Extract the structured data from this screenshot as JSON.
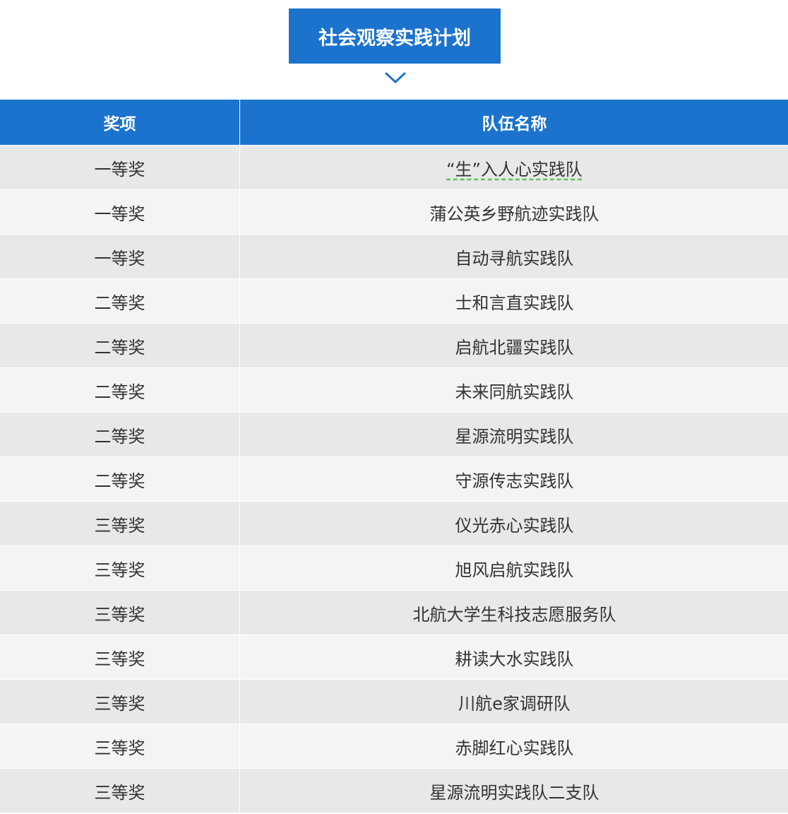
{
  "title": "社会观察实践计划",
  "colors": {
    "accent": "#1b73cd",
    "row_odd": "#e8e8e8",
    "row_even": "#f4f4f4",
    "text": "#333333"
  },
  "table": {
    "headers": [
      "奖项",
      "队伍名称"
    ],
    "rows": [
      {
        "award": "一等奖",
        "team": "“生”入人心实践队"
      },
      {
        "award": "一等奖",
        "team": "蒲公英乡野航迹实践队"
      },
      {
        "award": "一等奖",
        "team": "自动寻航实践队"
      },
      {
        "award": "二等奖",
        "team": "士和言直实践队"
      },
      {
        "award": "二等奖",
        "team": "启航北疆实践队"
      },
      {
        "award": "二等奖",
        "team": "未来同航实践队"
      },
      {
        "award": "二等奖",
        "team": "星源流明实践队"
      },
      {
        "award": "二等奖",
        "team": "守源传志实践队"
      },
      {
        "award": "三等奖",
        "team": "仪光赤心实践队"
      },
      {
        "award": "三等奖",
        "team": "旭风启航实践队"
      },
      {
        "award": "三等奖",
        "team": "北航大学生科技志愿服务队"
      },
      {
        "award": "三等奖",
        "team": "耕读大水实践队"
      },
      {
        "award": "三等奖",
        "team": "川航e家调研队"
      },
      {
        "award": "三等奖",
        "team": "赤脚红心实践队"
      },
      {
        "award": "三等奖",
        "team": "星源流明实践队二支队"
      }
    ]
  }
}
